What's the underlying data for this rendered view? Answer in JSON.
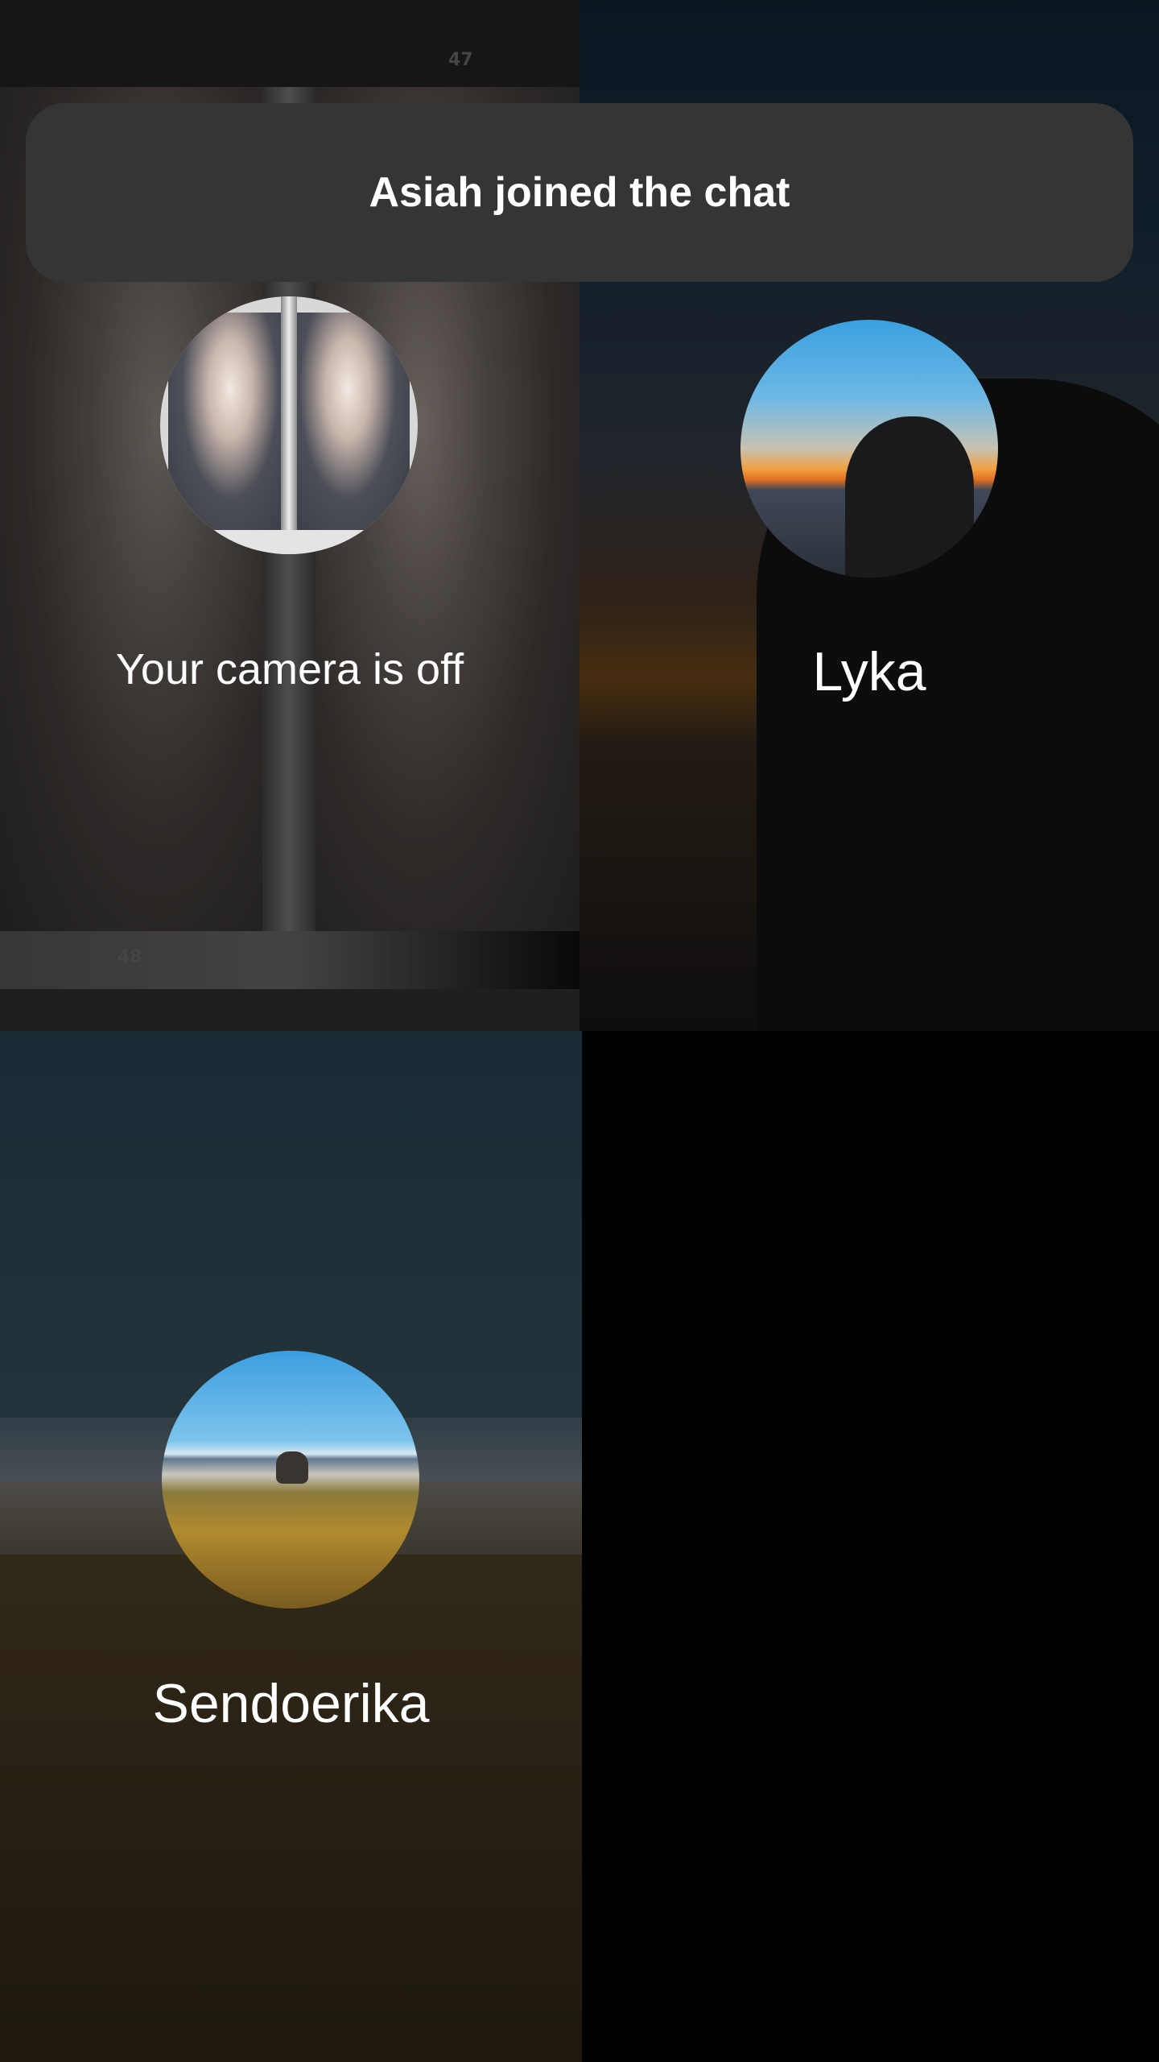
{
  "toast": {
    "message": "Asiah joined the chat"
  },
  "tiles": {
    "self": {
      "status": "Your camera is off",
      "photo_numbers": [
        "47",
        "48"
      ]
    },
    "participant_1": {
      "name": "Lyka"
    },
    "participant_2": {
      "name": "Sendoerika"
    }
  }
}
